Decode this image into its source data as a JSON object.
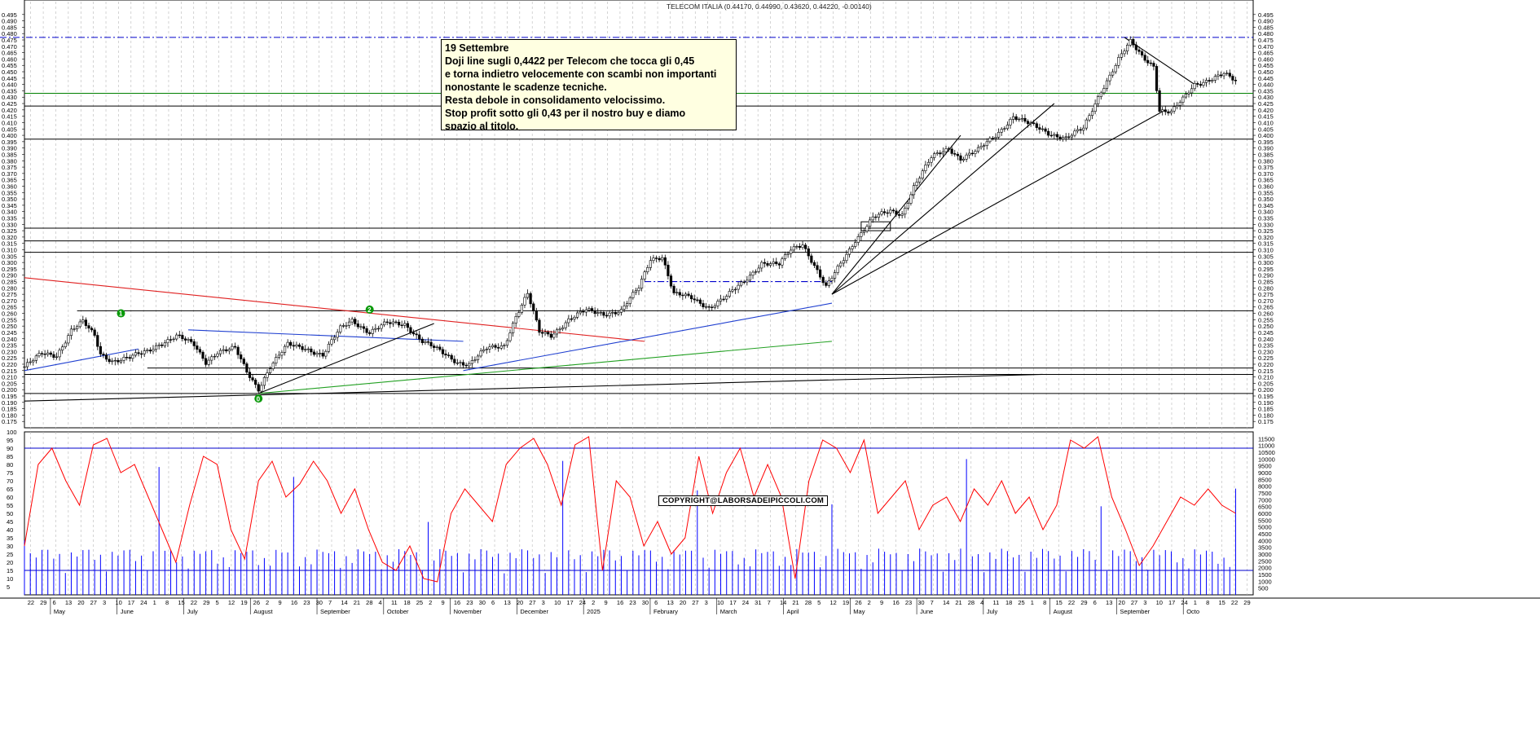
{
  "chart_data": [
    {
      "type": "candlestick",
      "title": "TELECOM ITALIA (0.44170, 0.44990, 0.43620, 0.44220, -0.00140)",
      "ylim": [
        0.17,
        0.5
      ],
      "yticks": [
        "0.495",
        "0.490",
        "0.485",
        "0.480",
        "0.475",
        "0.470",
        "0.465",
        "0.460",
        "0.455",
        "0.450",
        "0.445",
        "0.440",
        "0.435",
        "0.430",
        "0.425",
        "0.420",
        "0.415",
        "0.410",
        "0.405",
        "0.400",
        "0.395",
        "0.390",
        "0.385",
        "0.380",
        "0.375",
        "0.370",
        "0.365",
        "0.360",
        "0.355",
        "0.350",
        "0.345",
        "0.340",
        "0.335",
        "0.330",
        "0.325",
        "0.320",
        "0.315",
        "0.310",
        "0.305",
        "0.300",
        "0.295",
        "0.290",
        "0.285",
        "0.280",
        "0.275",
        "0.270",
        "0.265",
        "0.260",
        "0.255",
        "0.250",
        "0.245",
        "0.240",
        "0.235",
        "0.230",
        "0.225",
        "0.220",
        "0.215",
        "0.210",
        "0.205",
        "0.200",
        "0.195",
        "0.190",
        "0.185",
        "0.180",
        "0.175"
      ],
      "close_path": [
        [
          0,
          0.218
        ],
        [
          6,
          0.228
        ],
        [
          11,
          0.227
        ],
        [
          16,
          0.247
        ],
        [
          20,
          0.253
        ],
        [
          24,
          0.242
        ],
        [
          26,
          0.228
        ],
        [
          30,
          0.223
        ],
        [
          36,
          0.225
        ],
        [
          42,
          0.23
        ],
        [
          46,
          0.236
        ],
        [
          52,
          0.242
        ],
        [
          58,
          0.235
        ],
        [
          62,
          0.222
        ],
        [
          66,
          0.23
        ],
        [
          72,
          0.232
        ],
        [
          76,
          0.214
        ],
        [
          80,
          0.201
        ],
        [
          84,
          0.218
        ],
        [
          90,
          0.235
        ],
        [
          96,
          0.233
        ],
        [
          102,
          0.227
        ],
        [
          108,
          0.248
        ],
        [
          112,
          0.255
        ],
        [
          118,
          0.245
        ],
        [
          124,
          0.252
        ],
        [
          130,
          0.252
        ],
        [
          136,
          0.238
        ],
        [
          142,
          0.23
        ],
        [
          148,
          0.222
        ],
        [
          152,
          0.22
        ],
        [
          158,
          0.232
        ],
        [
          164,
          0.235
        ],
        [
          168,
          0.258
        ],
        [
          172,
          0.275
        ],
        [
          176,
          0.245
        ],
        [
          180,
          0.243
        ],
        [
          186,
          0.255
        ],
        [
          192,
          0.262
        ],
        [
          198,
          0.26
        ],
        [
          204,
          0.262
        ],
        [
          210,
          0.28
        ],
        [
          214,
          0.303
        ],
        [
          218,
          0.305
        ],
        [
          222,
          0.275
        ],
        [
          228,
          0.272
        ],
        [
          234,
          0.265
        ],
        [
          240,
          0.273
        ],
        [
          246,
          0.285
        ],
        [
          252,
          0.3
        ],
        [
          258,
          0.298
        ],
        [
          262,
          0.31
        ],
        [
          266,
          0.315
        ],
        [
          270,
          0.298
        ],
        [
          274,
          0.28
        ],
        [
          278,
          0.295
        ],
        [
          284,
          0.318
        ],
        [
          290,
          0.335
        ],
        [
          296,
          0.34
        ],
        [
          300,
          0.338
        ],
        [
          304,
          0.36
        ],
        [
          310,
          0.382
        ],
        [
          316,
          0.39
        ],
        [
          320,
          0.382
        ],
        [
          326,
          0.388
        ],
        [
          332,
          0.4
        ],
        [
          338,
          0.415
        ],
        [
          344,
          0.408
        ],
        [
          350,
          0.402
        ],
        [
          356,
          0.398
        ],
        [
          362,
          0.405
        ],
        [
          368,
          0.435
        ],
        [
          374,
          0.46
        ],
        [
          378,
          0.473
        ],
        [
          382,
          0.462
        ],
        [
          386,
          0.455
        ],
        [
          388,
          0.42
        ],
        [
          392,
          0.418
        ],
        [
          396,
          0.428
        ],
        [
          400,
          0.44
        ],
        [
          406,
          0.445
        ],
        [
          410,
          0.448
        ],
        [
          414,
          0.442
        ]
      ],
      "horizontal_levels": [
        0.477,
        0.433,
        0.423,
        0.397,
        0.327,
        0.317,
        0.308,
        0.262,
        0.217,
        0.212,
        0.197
      ],
      "signals": [
        "1",
        "2",
        "0"
      ],
      "annotation_lines": [
        "19 Settembre",
        "Doji line sugli 0,4422 per Telecom che tocca gli 0,45",
        "e torna indietro velocemente con scambi non importanti",
        "nonostante le scadenze tecniche.",
        "Resta debole in consolidamento velocissimo.",
        "Stop profit sotto gli 0,43 per il nostro buy e diamo",
        "spazio al titolo."
      ],
      "copyright": "COPYRIGHT@LABORSADEIPICCOLI.COM"
    },
    {
      "type": "line",
      "series": [
        {
          "values": [
            30,
            80,
            90,
            70,
            55,
            92,
            96,
            75,
            80,
            60,
            40,
            20,
            55,
            85,
            80,
            40,
            22,
            70,
            82,
            60,
            68,
            82,
            70,
            50,
            65,
            40,
            20,
            15,
            30,
            10,
            8,
            50,
            65,
            55,
            45,
            80,
            90,
            96,
            80,
            55,
            92,
            97,
            15,
            70,
            60,
            30,
            45,
            25,
            35,
            85,
            50,
            75,
            90,
            60,
            80,
            60,
            10,
            70,
            95,
            90,
            75,
            95,
            50,
            60,
            70,
            40,
            55,
            60,
            45,
            65,
            55,
            70,
            50,
            60,
            40,
            55,
            95,
            90,
            97,
            60,
            40,
            18,
            30,
            45,
            60,
            55,
            65,
            55,
            50
          ]
        }
      ],
      "ylim": [
        0,
        100
      ],
      "yticks_left": [
        "100",
        "95",
        "90",
        "85",
        "80",
        "75",
        "70",
        "65",
        "60",
        "55",
        "50",
        "45",
        "40",
        "35",
        "30",
        "25",
        "20",
        "15",
        "10",
        "5"
      ],
      "reference_levels": [
        90,
        15
      ]
    },
    {
      "type": "bar",
      "yticks_right": [
        "11500",
        "11000",
        "10500",
        "10000",
        "9500",
        "9000",
        "8500",
        "8000",
        "7500",
        "7000",
        "6500",
        "6000",
        "5500",
        "5000",
        "4500",
        "4000",
        "3500",
        "3000",
        "2500",
        "2000",
        "1500",
        "1000",
        "500"
      ],
      "ylim": [
        0,
        12000
      ]
    }
  ],
  "x_axis": {
    "day_labels": [
      "22",
      "29",
      "6",
      "13",
      "20",
      "27",
      "3",
      "10",
      "17",
      "24",
      "1",
      "8",
      "15",
      "22",
      "29",
      "5",
      "12",
      "19",
      "26",
      "2",
      "9",
      "16",
      "23",
      "30",
      "7",
      "14",
      "21",
      "28",
      "4",
      "11",
      "18",
      "25",
      "2",
      "9",
      "16",
      "23",
      "30",
      "6",
      "13",
      "20",
      "27",
      "3",
      "10",
      "17",
      "24",
      "2",
      "9",
      "16",
      "23",
      "30",
      "6",
      "13",
      "20",
      "27",
      "3",
      "10",
      "17",
      "24",
      "31",
      "7",
      "14",
      "21",
      "28",
      "5",
      "12",
      "19",
      "26",
      "2",
      "9",
      "16",
      "23",
      "30",
      "7",
      "14",
      "21",
      "28",
      "4",
      "11",
      "18",
      "25",
      "1",
      "8",
      "15",
      "22",
      "29",
      "6",
      "13",
      "20",
      "27",
      "3",
      "10",
      "17",
      "24",
      "1",
      "8",
      "15",
      "22",
      "29"
    ],
    "month_labels": [
      "May",
      "June",
      "July",
      "August",
      "September",
      "October",
      "November",
      "December",
      "2025",
      "February",
      "March",
      "April",
      "May",
      "June",
      "July",
      "August",
      "September",
      "Octo"
    ]
  },
  "colors": {
    "price": "#000000",
    "level": "#000000",
    "green_level": "#008000",
    "blue_dashdot": "#0000cc",
    "red_trend": "#e02020",
    "blue_trend": "#1f3fd0",
    "green_trend": "#22a022",
    "oscillator": "#ff0000",
    "volume": "#0000ff",
    "signal": "#0a9a0a",
    "annotation_bg": "#ffffe1"
  }
}
